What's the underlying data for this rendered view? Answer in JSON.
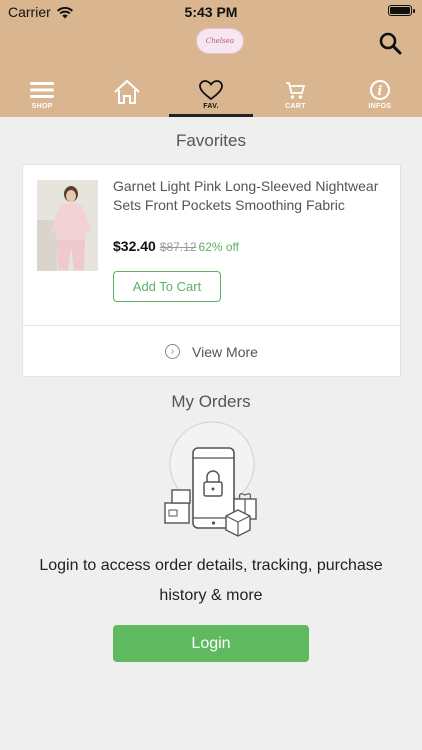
{
  "status_bar": {
    "carrier": "Carrier",
    "time": "5:43 PM"
  },
  "header": {
    "logo_text": "Chelsea",
    "tabs": [
      {
        "label": "SHOP",
        "icon": "menu-icon"
      },
      {
        "label": "",
        "icon": "home-icon"
      },
      {
        "label": "FAV.",
        "icon": "heart-icon",
        "active": true
      },
      {
        "label": "CART",
        "icon": "cart-icon"
      },
      {
        "label": "INFOS",
        "icon": "info-icon"
      }
    ]
  },
  "favorites": {
    "title": "Favorites",
    "items": [
      {
        "name": "Garnet Light Pink Long-Sleeved Nightwear Sets Front Pockets Smoothing Fabric",
        "price": "$32.40",
        "old_price": "$87.12",
        "discount": "62% off",
        "add_to_cart_label": "Add To Cart"
      }
    ],
    "view_more_label": "View More"
  },
  "orders": {
    "title": "My Orders",
    "message": "Login to access order details, tracking, purchase history & more",
    "login_label": "Login"
  },
  "colors": {
    "header_bg": "#d9b68f",
    "accent_green": "#5eb95f",
    "page_bg": "#efefef"
  }
}
